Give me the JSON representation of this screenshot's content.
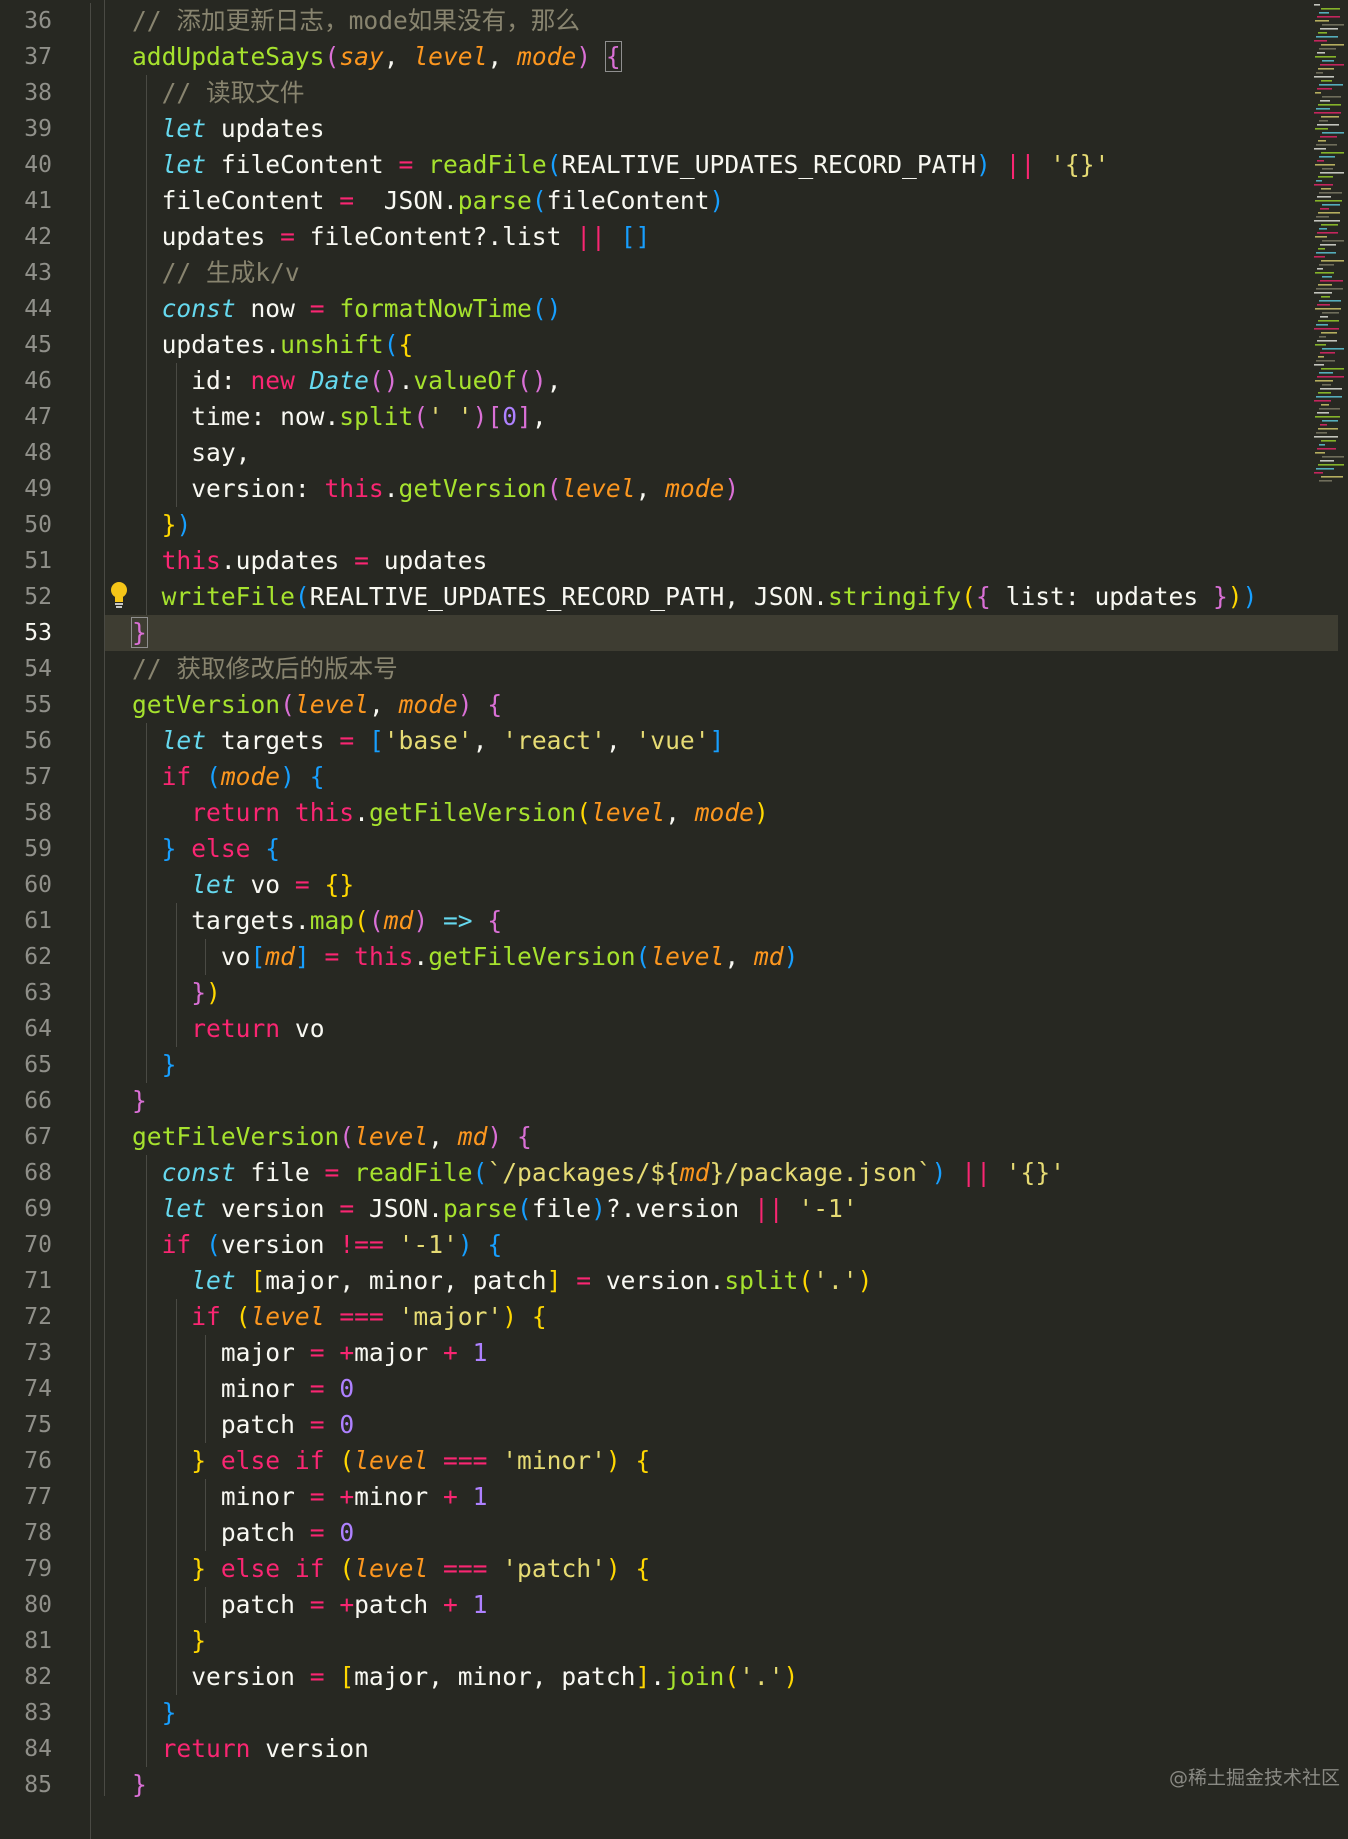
{
  "editor": {
    "first_line_number": 36,
    "active_line_number": 53,
    "lightbulb_line_number": 52,
    "lines": [
      [
        [
          "// 添加更新日志，mode如果没有，那么",
          "comment"
        ]
      ],
      [
        [
          "addUpdateSays",
          "fn"
        ],
        [
          "(",
          "b2"
        ],
        [
          "say",
          "param"
        ],
        [
          ", ",
          ""
        ],
        [
          "level",
          "param"
        ],
        [
          ", ",
          ""
        ],
        [
          "mode",
          "param"
        ],
        [
          ")",
          "b2"
        ],
        [
          " ",
          ""
        ],
        [
          "{",
          "b2-match"
        ]
      ],
      [
        [
          "  // 读取文件",
          "comment"
        ]
      ],
      [
        [
          "  ",
          ""
        ],
        [
          "let",
          "store"
        ],
        [
          " updates",
          ""
        ]
      ],
      [
        [
          "  ",
          ""
        ],
        [
          "let",
          "store"
        ],
        [
          " fileContent ",
          ""
        ],
        [
          "=",
          "op"
        ],
        [
          " ",
          ""
        ],
        [
          "readFile",
          "fn"
        ],
        [
          "(",
          "b3"
        ],
        [
          "REALTIVE_UPDATES_RECORD_PATH",
          ""
        ],
        [
          ")",
          "b3"
        ],
        [
          " ",
          ""
        ],
        [
          "||",
          "op"
        ],
        [
          " ",
          ""
        ],
        [
          "'{}'",
          "str"
        ]
      ],
      [
        [
          "  fileContent ",
          ""
        ],
        [
          "=",
          "op"
        ],
        [
          "  JSON.",
          ""
        ],
        [
          "parse",
          "fn"
        ],
        [
          "(",
          "b3"
        ],
        [
          "fileContent",
          ""
        ],
        [
          ")",
          "b3"
        ]
      ],
      [
        [
          "  updates ",
          ""
        ],
        [
          "=",
          "op"
        ],
        [
          " fileContent?.list ",
          ""
        ],
        [
          "||",
          "op"
        ],
        [
          " ",
          ""
        ],
        [
          "[]",
          "b3"
        ]
      ],
      [
        [
          "  // 生成k/v",
          "comment"
        ]
      ],
      [
        [
          "  ",
          ""
        ],
        [
          "const",
          "store"
        ],
        [
          " now ",
          ""
        ],
        [
          "=",
          "op"
        ],
        [
          " ",
          ""
        ],
        [
          "formatNowTime",
          "fn"
        ],
        [
          "()",
          "b3"
        ]
      ],
      [
        [
          "  updates.",
          ""
        ],
        [
          "unshift",
          "fn"
        ],
        [
          "(",
          "b3"
        ],
        [
          "{",
          "b1"
        ]
      ],
      [
        [
          "    id: ",
          ""
        ],
        [
          "new",
          "kw"
        ],
        [
          " ",
          ""
        ],
        [
          "Date",
          "cls"
        ],
        [
          "()",
          "b2"
        ],
        [
          ".",
          ""
        ],
        [
          "valueOf",
          "fn"
        ],
        [
          "()",
          "b2"
        ],
        [
          ",",
          ""
        ]
      ],
      [
        [
          "    time: now.",
          ""
        ],
        [
          "split",
          "fn"
        ],
        [
          "(",
          "b2"
        ],
        [
          "' '",
          "str"
        ],
        [
          ")",
          "b2"
        ],
        [
          "[",
          "b2"
        ],
        [
          "0",
          "num"
        ],
        [
          "]",
          "b2"
        ],
        [
          ",",
          ""
        ]
      ],
      [
        [
          "    say,",
          ""
        ]
      ],
      [
        [
          "    version: ",
          ""
        ],
        [
          "this",
          "kw"
        ],
        [
          ".",
          ""
        ],
        [
          "getVersion",
          "fn"
        ],
        [
          "(",
          "b2"
        ],
        [
          "level",
          "param"
        ],
        [
          ", ",
          ""
        ],
        [
          "mode",
          "param"
        ],
        [
          ")",
          "b2"
        ]
      ],
      [
        [
          "  ",
          ""
        ],
        [
          "}",
          "b1"
        ],
        [
          ")",
          "b3"
        ]
      ],
      [
        [
          "  ",
          ""
        ],
        [
          "this",
          "kw"
        ],
        [
          ".updates ",
          ""
        ],
        [
          "=",
          "op"
        ],
        [
          " updates",
          ""
        ]
      ],
      [
        [
          "  ",
          ""
        ],
        [
          "writeFile",
          "fn"
        ],
        [
          "(",
          "b3"
        ],
        [
          "REALTIVE_UPDATES_RECORD_PATH, JSON.",
          ""
        ],
        [
          "stringify",
          "fn"
        ],
        [
          "(",
          "b1"
        ],
        [
          "{",
          "b2"
        ],
        [
          " list: updates ",
          ""
        ],
        [
          "}",
          "b2"
        ],
        [
          ")",
          "b1"
        ],
        [
          ")",
          "b3"
        ]
      ],
      [
        [
          "}",
          "b2-match"
        ]
      ],
      [
        [
          "// 获取修改后的版本号",
          "comment"
        ]
      ],
      [
        [
          "getVersion",
          "fn"
        ],
        [
          "(",
          "b2"
        ],
        [
          "level",
          "param"
        ],
        [
          ", ",
          ""
        ],
        [
          "mode",
          "param"
        ],
        [
          ")",
          "b2"
        ],
        [
          " ",
          ""
        ],
        [
          "{",
          "b2"
        ]
      ],
      [
        [
          "  ",
          ""
        ],
        [
          "let",
          "store"
        ],
        [
          " targets ",
          ""
        ],
        [
          "=",
          "op"
        ],
        [
          " ",
          ""
        ],
        [
          "[",
          "b3"
        ],
        [
          "'base'",
          "str"
        ],
        [
          ", ",
          ""
        ],
        [
          "'react'",
          "str"
        ],
        [
          ", ",
          ""
        ],
        [
          "'vue'",
          "str"
        ],
        [
          "]",
          "b3"
        ]
      ],
      [
        [
          "  ",
          ""
        ],
        [
          "if",
          "kw"
        ],
        [
          " ",
          ""
        ],
        [
          "(",
          "b3"
        ],
        [
          "mode",
          "param"
        ],
        [
          ")",
          "b3"
        ],
        [
          " ",
          ""
        ],
        [
          "{",
          "b3"
        ]
      ],
      [
        [
          "    ",
          ""
        ],
        [
          "return",
          "kw"
        ],
        [
          " ",
          ""
        ],
        [
          "this",
          "kw"
        ],
        [
          ".",
          ""
        ],
        [
          "getFileVersion",
          "fn"
        ],
        [
          "(",
          "b1"
        ],
        [
          "level",
          "param"
        ],
        [
          ", ",
          ""
        ],
        [
          "mode",
          "param"
        ],
        [
          ")",
          "b1"
        ]
      ],
      [
        [
          "  ",
          ""
        ],
        [
          "}",
          "b3"
        ],
        [
          " ",
          ""
        ],
        [
          "else",
          "kw"
        ],
        [
          " ",
          ""
        ],
        [
          "{",
          "b3"
        ]
      ],
      [
        [
          "    ",
          ""
        ],
        [
          "let",
          "store"
        ],
        [
          " vo ",
          ""
        ],
        [
          "=",
          "op"
        ],
        [
          " ",
          ""
        ],
        [
          "{}",
          "b1"
        ]
      ],
      [
        [
          "    targets.",
          ""
        ],
        [
          "map",
          "fn"
        ],
        [
          "(",
          "b1"
        ],
        [
          "(",
          "b2"
        ],
        [
          "md",
          "param"
        ],
        [
          ")",
          "b2"
        ],
        [
          " ",
          ""
        ],
        [
          "=>",
          "store"
        ],
        [
          " ",
          ""
        ],
        [
          "{",
          "b2"
        ]
      ],
      [
        [
          "      vo",
          ""
        ],
        [
          "[",
          "b3"
        ],
        [
          "md",
          "param"
        ],
        [
          "]",
          "b3"
        ],
        [
          " ",
          ""
        ],
        [
          "=",
          "op"
        ],
        [
          " ",
          ""
        ],
        [
          "this",
          "kw"
        ],
        [
          ".",
          ""
        ],
        [
          "getFileVersion",
          "fn"
        ],
        [
          "(",
          "b3"
        ],
        [
          "level",
          "param"
        ],
        [
          ", ",
          ""
        ],
        [
          "md",
          "param"
        ],
        [
          ")",
          "b3"
        ]
      ],
      [
        [
          "    ",
          ""
        ],
        [
          "}",
          "b2"
        ],
        [
          ")",
          "b1"
        ]
      ],
      [
        [
          "    ",
          ""
        ],
        [
          "return",
          "kw"
        ],
        [
          " vo",
          ""
        ]
      ],
      [
        [
          "  ",
          ""
        ],
        [
          "}",
          "b3"
        ]
      ],
      [
        [
          "}",
          "b2"
        ]
      ],
      [
        [
          "getFileVersion",
          "fn"
        ],
        [
          "(",
          "b2"
        ],
        [
          "level",
          "param"
        ],
        [
          ", ",
          ""
        ],
        [
          "md",
          "param"
        ],
        [
          ")",
          "b2"
        ],
        [
          " ",
          ""
        ],
        [
          "{",
          "b2"
        ]
      ],
      [
        [
          "  ",
          ""
        ],
        [
          "const",
          "store"
        ],
        [
          " file ",
          ""
        ],
        [
          "=",
          "op"
        ],
        [
          " ",
          ""
        ],
        [
          "readFile",
          "fn"
        ],
        [
          "(",
          "b3"
        ],
        [
          "`/packages/${",
          "str"
        ],
        [
          "md",
          "param"
        ],
        [
          "}/package.json`",
          "str"
        ],
        [
          ")",
          "b3"
        ],
        [
          " ",
          ""
        ],
        [
          "||",
          "op"
        ],
        [
          " ",
          ""
        ],
        [
          "'{}'",
          "str"
        ]
      ],
      [
        [
          "  ",
          ""
        ],
        [
          "let",
          "store"
        ],
        [
          " version ",
          ""
        ],
        [
          "=",
          "op"
        ],
        [
          " JSON.",
          ""
        ],
        [
          "parse",
          "fn"
        ],
        [
          "(",
          "b3"
        ],
        [
          "file",
          ""
        ],
        [
          ")",
          "b3"
        ],
        [
          "?.version ",
          ""
        ],
        [
          "||",
          "op"
        ],
        [
          " ",
          ""
        ],
        [
          "'-1'",
          "str"
        ]
      ],
      [
        [
          "  ",
          ""
        ],
        [
          "if",
          "kw"
        ],
        [
          " ",
          ""
        ],
        [
          "(",
          "b3"
        ],
        [
          "version ",
          ""
        ],
        [
          "!==",
          "op"
        ],
        [
          " ",
          ""
        ],
        [
          "'-1'",
          "str"
        ],
        [
          ")",
          "b3"
        ],
        [
          " ",
          ""
        ],
        [
          "{",
          "b3"
        ]
      ],
      [
        [
          "    ",
          ""
        ],
        [
          "let",
          "store"
        ],
        [
          " ",
          ""
        ],
        [
          "[",
          "b1"
        ],
        [
          "major, minor, patch",
          ""
        ],
        [
          "]",
          "b1"
        ],
        [
          " ",
          ""
        ],
        [
          "=",
          "op"
        ],
        [
          " version.",
          ""
        ],
        [
          "split",
          "fn"
        ],
        [
          "(",
          "b1"
        ],
        [
          "'.'",
          "str"
        ],
        [
          ")",
          "b1"
        ]
      ],
      [
        [
          "    ",
          ""
        ],
        [
          "if",
          "kw"
        ],
        [
          " ",
          ""
        ],
        [
          "(",
          "b1"
        ],
        [
          "level",
          "param"
        ],
        [
          " ",
          ""
        ],
        [
          "===",
          "op"
        ],
        [
          " ",
          ""
        ],
        [
          "'major'",
          "str"
        ],
        [
          ")",
          "b1"
        ],
        [
          " ",
          ""
        ],
        [
          "{",
          "b1"
        ]
      ],
      [
        [
          "      major ",
          ""
        ],
        [
          "=",
          "op"
        ],
        [
          " ",
          ""
        ],
        [
          "+",
          "op"
        ],
        [
          "major ",
          ""
        ],
        [
          "+",
          "op"
        ],
        [
          " ",
          ""
        ],
        [
          "1",
          "num"
        ]
      ],
      [
        [
          "      minor ",
          ""
        ],
        [
          "=",
          "op"
        ],
        [
          " ",
          ""
        ],
        [
          "0",
          "num"
        ]
      ],
      [
        [
          "      patch ",
          ""
        ],
        [
          "=",
          "op"
        ],
        [
          " ",
          ""
        ],
        [
          "0",
          "num"
        ]
      ],
      [
        [
          "    ",
          ""
        ],
        [
          "}",
          "b1"
        ],
        [
          " ",
          ""
        ],
        [
          "else",
          "kw"
        ],
        [
          " ",
          ""
        ],
        [
          "if",
          "kw"
        ],
        [
          " ",
          ""
        ],
        [
          "(",
          "b1"
        ],
        [
          "level",
          "param"
        ],
        [
          " ",
          ""
        ],
        [
          "===",
          "op"
        ],
        [
          " ",
          ""
        ],
        [
          "'minor'",
          "str"
        ],
        [
          ")",
          "b1"
        ],
        [
          " ",
          ""
        ],
        [
          "{",
          "b1"
        ]
      ],
      [
        [
          "      minor ",
          ""
        ],
        [
          "=",
          "op"
        ],
        [
          " ",
          ""
        ],
        [
          "+",
          "op"
        ],
        [
          "minor ",
          ""
        ],
        [
          "+",
          "op"
        ],
        [
          " ",
          ""
        ],
        [
          "1",
          "num"
        ]
      ],
      [
        [
          "      patch ",
          ""
        ],
        [
          "=",
          "op"
        ],
        [
          " ",
          ""
        ],
        [
          "0",
          "num"
        ]
      ],
      [
        [
          "    ",
          ""
        ],
        [
          "}",
          "b1"
        ],
        [
          " ",
          ""
        ],
        [
          "else",
          "kw"
        ],
        [
          " ",
          ""
        ],
        [
          "if",
          "kw"
        ],
        [
          " ",
          ""
        ],
        [
          "(",
          "b1"
        ],
        [
          "level",
          "param"
        ],
        [
          " ",
          ""
        ],
        [
          "===",
          "op"
        ],
        [
          " ",
          ""
        ],
        [
          "'patch'",
          "str"
        ],
        [
          ")",
          "b1"
        ],
        [
          " ",
          ""
        ],
        [
          "{",
          "b1"
        ]
      ],
      [
        [
          "      patch ",
          ""
        ],
        [
          "=",
          "op"
        ],
        [
          " ",
          ""
        ],
        [
          "+",
          "op"
        ],
        [
          "patch ",
          ""
        ],
        [
          "+",
          "op"
        ],
        [
          " ",
          ""
        ],
        [
          "1",
          "num"
        ]
      ],
      [
        [
          "    ",
          ""
        ],
        [
          "}",
          "b1"
        ]
      ],
      [
        [
          "    version ",
          ""
        ],
        [
          "=",
          "op"
        ],
        [
          " ",
          ""
        ],
        [
          "[",
          "b1"
        ],
        [
          "major, minor, patch",
          ""
        ],
        [
          "]",
          "b1"
        ],
        [
          ".",
          ""
        ],
        [
          "join",
          "fn"
        ],
        [
          "(",
          "b1"
        ],
        [
          "'.'",
          "str"
        ],
        [
          ")",
          "b1"
        ]
      ],
      [
        [
          "  ",
          ""
        ],
        [
          "}",
          "b3"
        ]
      ],
      [
        [
          "  ",
          ""
        ],
        [
          "return",
          "kw"
        ],
        [
          " version",
          ""
        ]
      ],
      [
        [
          "}",
          "b2"
        ]
      ]
    ]
  },
  "watermark": "@稀土掘金技术社区",
  "theme": {
    "background": "#272822",
    "active_line": "#3e3d32",
    "bulb": "#f5c518"
  }
}
